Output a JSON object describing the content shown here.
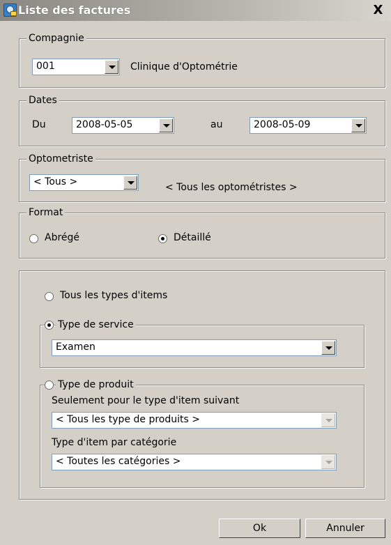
{
  "window": {
    "title": "Liste des factures",
    "close_label": "X"
  },
  "compagnie": {
    "legend": "Compagnie",
    "code": "001",
    "name": "Clinique d'Optométrie"
  },
  "dates": {
    "legend": "Dates",
    "from_label": "Du",
    "from_value": "2008-05-05",
    "to_label": "au",
    "to_value": "2008-05-09"
  },
  "optometriste": {
    "legend": "Optometriste",
    "value": "< Tous >",
    "description": "< Tous les optométristes >"
  },
  "format": {
    "legend": "Format",
    "abrege_label": "Abrégé",
    "detaille_label": "Détaillé",
    "selected": "Détaillé"
  },
  "items": {
    "all_types_label": "Tous les types d'items",
    "service": {
      "label": "Type de service",
      "value": "Examen"
    },
    "produit": {
      "label": "Type de produit",
      "subtype_label": "Seulement pour le type d'item suivant",
      "subtype_value": "< Tous les type de produits >",
      "category_label": "Type d'item par catégorie",
      "category_value": "< Toutes les catégories >"
    },
    "selected": "Type de service"
  },
  "buttons": {
    "ok": "Ok",
    "cancel": "Annuler"
  },
  "icons": {
    "window": "app-icon",
    "close": "close-icon",
    "dropdown": "chevron-down-icon"
  },
  "colors": {
    "dialog_bg": "#d4d0c8",
    "field_border": "#7f9db9",
    "title_gradient_start": "#8a8882"
  }
}
